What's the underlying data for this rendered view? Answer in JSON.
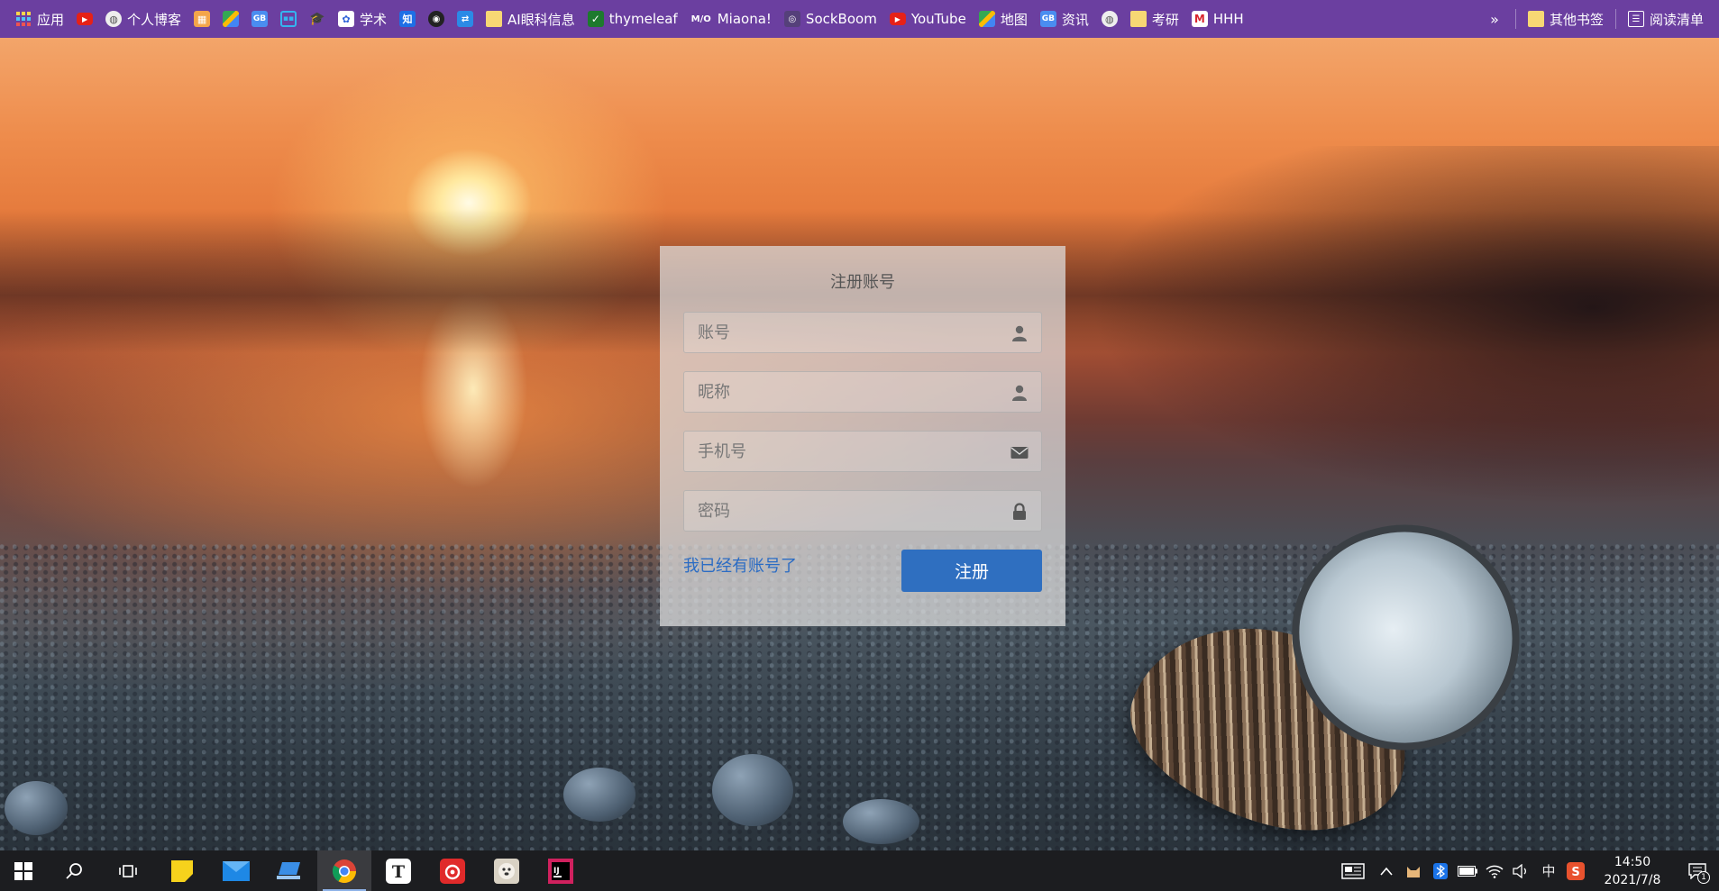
{
  "bookmarks": {
    "items": [
      {
        "icon": "apps-grid-icon",
        "label": "应用"
      },
      {
        "icon": "youtube-icon",
        "label": ""
      },
      {
        "icon": "globe-icon",
        "label": "个人博客"
      },
      {
        "icon": "store-icon",
        "label": ""
      },
      {
        "icon": "maps-icon",
        "label": ""
      },
      {
        "icon": "gb-icon",
        "label": ""
      },
      {
        "icon": "bilibili-icon",
        "label": ""
      },
      {
        "icon": "scholar-cap-icon",
        "label": ""
      },
      {
        "icon": "baidu-scholar-icon",
        "label": "学术"
      },
      {
        "icon": "zhihu-icon",
        "label": ""
      },
      {
        "icon": "github-icon",
        "label": ""
      },
      {
        "icon": "translate-icon",
        "label": ""
      },
      {
        "icon": "folder-icon",
        "label": "AI眼科信息"
      },
      {
        "icon": "thymeleaf-icon",
        "label": "thymeleaf"
      },
      {
        "icon": "miaona-icon",
        "label": "Miaona!"
      },
      {
        "icon": "sockboom-icon",
        "label": "SockBoom"
      },
      {
        "icon": "youtube-icon",
        "label": "YouTube"
      },
      {
        "icon": "maps-icon",
        "label": "地图"
      },
      {
        "icon": "gb-icon",
        "label": "资讯"
      },
      {
        "icon": "globe-icon",
        "label": ""
      },
      {
        "icon": "folder-icon",
        "label": "考研"
      },
      {
        "icon": "m-logo-icon",
        "label": "HHH"
      }
    ],
    "more_label": "»",
    "other_label": "其他书签",
    "reading_label": "阅读清单"
  },
  "register": {
    "title": "注册账号",
    "account_placeholder": "账号",
    "nickname_placeholder": "昵称",
    "phone_placeholder": "手机号",
    "password_placeholder": "密码",
    "login_link": "我已经有账号了",
    "submit_label": "注册"
  },
  "taskbar": {
    "time": "14:50",
    "date": "2021/7/8",
    "ime": "中",
    "notification_count": "1"
  },
  "colors": {
    "bookmark_bar": "#6b3fa0",
    "accent": "#2f6fc0",
    "link": "#2b6cc4"
  }
}
